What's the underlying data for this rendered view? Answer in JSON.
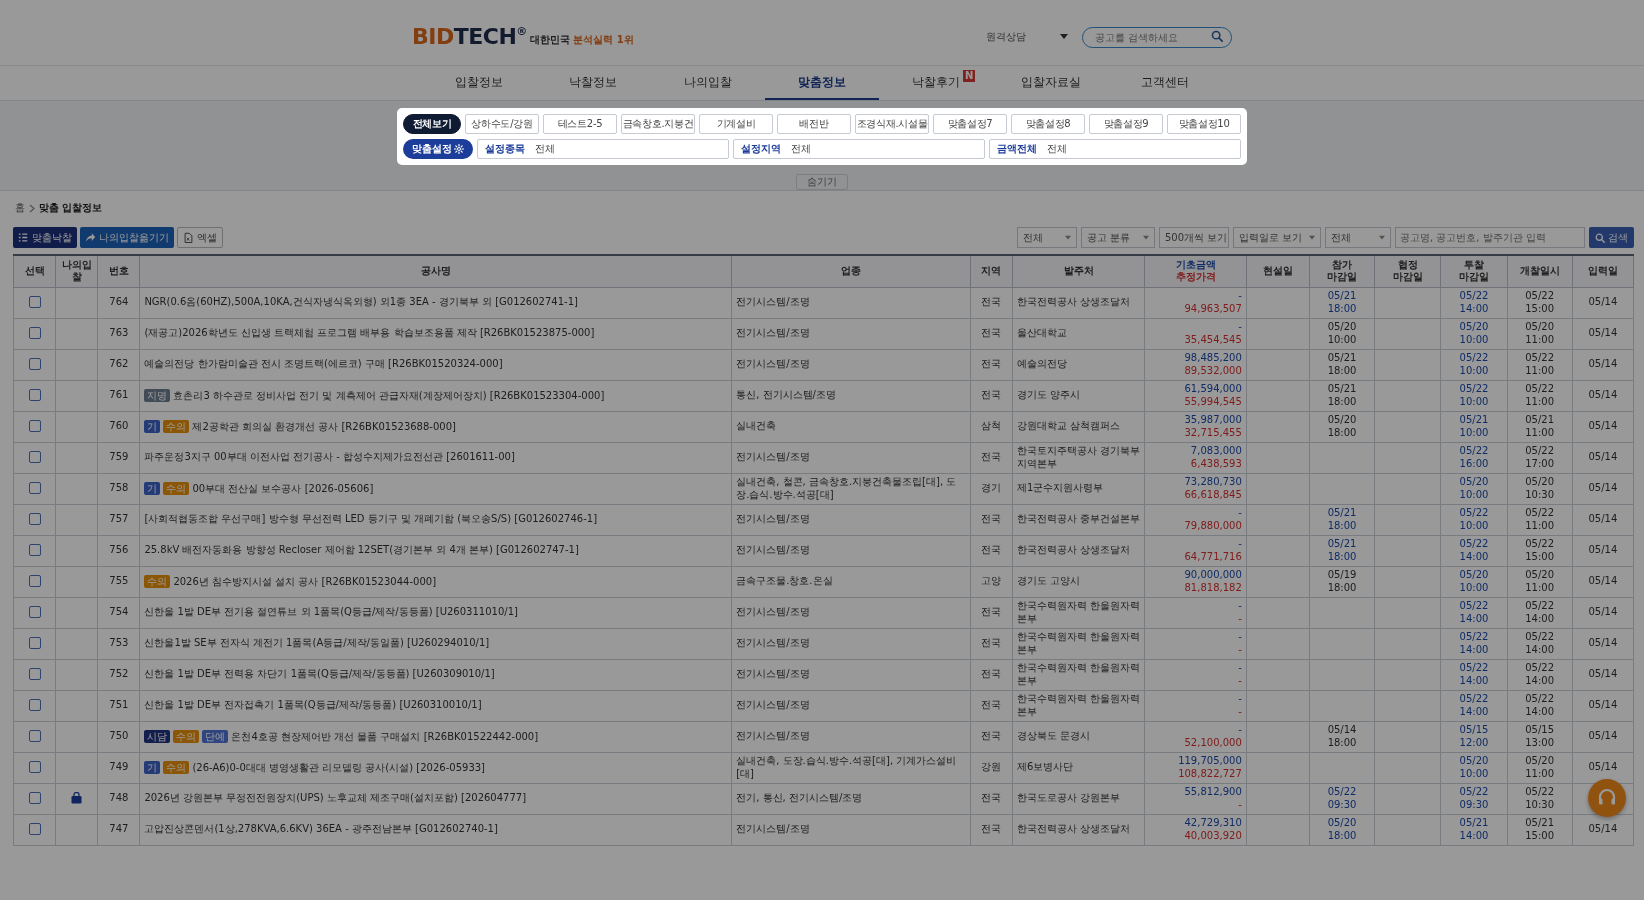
{
  "header": {
    "logo": {
      "part_1": "BID",
      "part_2": "TECH",
      "mark": "®"
    },
    "tagline": {
      "part_1": "대한민국",
      "part_2": "분석실력 1위"
    },
    "remote_support": "원격상담",
    "search": {
      "placeholder": "공고를 검색하세요"
    }
  },
  "nav": [
    {
      "label": "입찰정보",
      "selected": false
    },
    {
      "label": "낙찰정보",
      "selected": false
    },
    {
      "label": "나의입찰",
      "selected": false
    },
    {
      "label": "맞춤정보",
      "selected": true
    },
    {
      "label": "낙찰후기",
      "selected": false,
      "badge": "N"
    },
    {
      "label": "입찰자료실",
      "selected": false
    },
    {
      "label": "고객센터",
      "selected": false
    }
  ],
  "overlay": {
    "dimmed": true
  },
  "filter_panel": {
    "presets": [
      {
        "label": "전체보기",
        "selected": true
      },
      {
        "label": "상하수도/강원",
        "selected": false
      },
      {
        "label": "테스트2-5",
        "selected": false
      },
      {
        "label": "금속창호.지붕건",
        "selected": false
      },
      {
        "label": "기계설비",
        "selected": false
      },
      {
        "label": "배전반",
        "selected": false
      },
      {
        "label": "조경식재.시설물",
        "selected": false
      },
      {
        "label": "맞춤설정7",
        "selected": false
      },
      {
        "label": "맞춤설정8",
        "selected": false
      },
      {
        "label": "맞춤설정9",
        "selected": false
      },
      {
        "label": "맞춤설정10",
        "selected": false
      }
    ],
    "settings_button": "맞춤설정",
    "fields": [
      {
        "label": "설정종목",
        "value": "전체"
      },
      {
        "label": "설정지역",
        "value": "전체"
      },
      {
        "label": "금액전체",
        "value": "전체"
      }
    ]
  },
  "hide_button": "숨기기",
  "breadcrumb": [
    "홈",
    "맞춤 입찰정보"
  ],
  "toolbar": {
    "buttons": [
      {
        "label": "맞춤낙찰",
        "kind": "primary"
      },
      {
        "label": "나의입찰옮기기",
        "kind": "secondary"
      },
      {
        "label": "엑셀",
        "kind": "plain"
      }
    ],
    "selects": [
      "전체",
      "공고 분류",
      "500개씩 보기",
      "입력일로 보기",
      "전체"
    ],
    "search": {
      "placeholder": "공고명, 공고번호, 발주기관 입력"
    },
    "search_button": "검색"
  },
  "table": {
    "columns": [
      {
        "lines": [
          "선택"
        ],
        "kind": "plain"
      },
      {
        "lines": [
          "나의입찰"
        ],
        "kind": "plain"
      },
      {
        "lines": [
          "번호"
        ],
        "kind": "plain"
      },
      {
        "lines": [
          "공사명"
        ],
        "kind": "plain"
      },
      {
        "lines": [
          "업종"
        ],
        "kind": "plain"
      },
      {
        "lines": [
          "지역"
        ],
        "kind": "plain"
      },
      {
        "lines": [
          "발주처"
        ],
        "kind": "plain"
      },
      {
        "lines": [
          "기초금액",
          "추정가격"
        ],
        "kind": "price"
      },
      {
        "lines": [
          "현설일"
        ],
        "kind": "plain"
      },
      {
        "lines": [
          "참가",
          "마감일"
        ],
        "kind": "plain"
      },
      {
        "lines": [
          "협정",
          "마감일"
        ],
        "kind": "plain"
      },
      {
        "lines": [
          "투찰",
          "마감일"
        ],
        "kind": "plain"
      },
      {
        "lines": [
          "개찰일시"
        ],
        "kind": "plain"
      },
      {
        "lines": [
          "입력일"
        ],
        "kind": "plain"
      }
    ],
    "rows": [
      {
        "checked": false,
        "my_bid": false,
        "no": "764",
        "title": "NGR(0.6옴(60HZ),500A,10KA,건식자냉식옥외형) 외1종 3EA - 경기북부 외 [G012602741-1]",
        "industry": "전기시스템/조명",
        "region": "전국",
        "agency": "한국전력공사 상생조달처",
        "base_price": "-",
        "est_price": "94,963,507",
        "entry_deadline": {
          "date": "05/21",
          "time": "18:00",
          "emphasis": true
        },
        "bid_deadline": {
          "date": "05/22",
          "time": "14:00"
        },
        "opening": {
          "date": "05/22",
          "time": "15:00"
        },
        "input_date": "05/14"
      },
      {
        "checked": false,
        "my_bid": false,
        "no": "763",
        "title": "(재공고)2026학년도 신입생 트랙체험 프로그램 배부용 학습보조용품 제작 [R26BK01523875-000]",
        "industry": "전기시스템/조명",
        "region": "전국",
        "agency": "울산대학교",
        "base_price": "-",
        "est_price": "35,454,545",
        "entry_deadline": {
          "date": "05/20",
          "time": "10:00",
          "emphasis": false
        },
        "bid_deadline": {
          "date": "05/20",
          "time": "10:00"
        },
        "opening": {
          "date": "05/20",
          "time": "11:00"
        },
        "input_date": "05/14"
      },
      {
        "checked": false,
        "my_bid": false,
        "no": "762",
        "title": "예술의전당 한가람미술관 전시 조명트랙(에르코) 구매 [R26BK01520324-000]",
        "industry": "전기시스템/조명",
        "region": "전국",
        "agency": "예술의전당",
        "base_price": "98,485,200",
        "est_price": "89,532,000",
        "entry_deadline": {
          "date": "05/21",
          "time": "18:00",
          "emphasis": false
        },
        "bid_deadline": {
          "date": "05/22",
          "time": "10:00"
        },
        "opening": {
          "date": "05/22",
          "time": "11:00"
        },
        "input_date": "05/14"
      },
      {
        "checked": false,
        "my_bid": false,
        "no": "761",
        "tags": [
          {
            "label": "지명",
            "kind": "nominated"
          }
        ],
        "title": "효촌리3 하수관로 정비사업 전기 및 계측제어 관급자재(계장제어장치) [R26BK01523304-000]",
        "industry": "통신, 전기시스템/조명",
        "region": "전국",
        "agency": "경기도 양주시",
        "base_price": "61,594,000",
        "est_price": "55,994,545",
        "entry_deadline": {
          "date": "05/21",
          "time": "18:00",
          "emphasis": false
        },
        "bid_deadline": {
          "date": "05/22",
          "time": "10:00"
        },
        "opening": {
          "date": "05/22",
          "time": "11:00"
        },
        "input_date": "05/14"
      },
      {
        "checked": false,
        "my_bid": false,
        "no": "760",
        "tags": [
          {
            "label": "기",
            "kind": "gi"
          },
          {
            "label": "수의",
            "kind": "private"
          }
        ],
        "title": "제2공학관 회의실 환경개선 공사 [R26BK01523688-000]",
        "industry": "실내건축",
        "region": "삼척",
        "agency": "강원대학교 삼척캠퍼스",
        "base_price": "35,987,000",
        "est_price": "32,715,455",
        "entry_deadline": {
          "date": "05/20",
          "time": "18:00",
          "emphasis": false
        },
        "bid_deadline": {
          "date": "05/21",
          "time": "10:00"
        },
        "opening": {
          "date": "05/21",
          "time": "11:00"
        },
        "input_date": "05/14"
      },
      {
        "checked": false,
        "my_bid": false,
        "no": "759",
        "title": "파주운정3지구 00부대 이전사업 전기공사 - 합성수지제가요전선관 [2601611-00]",
        "industry": "전기시스템/조명",
        "region": "전국",
        "agency": "한국토지주택공사 경기북부지역본부",
        "base_price": "7,083,000",
        "est_price": "6,438,593",
        "bid_deadline": {
          "date": "05/22",
          "time": "16:00"
        },
        "opening": {
          "date": "05/22",
          "time": "17:00"
        },
        "input_date": "05/14"
      },
      {
        "checked": false,
        "my_bid": false,
        "no": "758",
        "tags": [
          {
            "label": "기",
            "kind": "gi"
          },
          {
            "label": "수의",
            "kind": "private"
          }
        ],
        "title": "00부대 전산실 보수공사 [2026-05606]",
        "industry": "실내건축, 철콘, 금속창호.지붕건축물조립[대], 도장.습식.방수.석공[대]",
        "region": "경기",
        "agency": "제1군수지원사령부",
        "base_price": "73,280,730",
        "est_price": "66,618,845",
        "bid_deadline": {
          "date": "05/20",
          "time": "10:00"
        },
        "opening": {
          "date": "05/20",
          "time": "10:30"
        },
        "input_date": "05/14"
      },
      {
        "checked": false,
        "my_bid": false,
        "no": "757",
        "title": "[사회적협동조합 우선구매] 방수형 무선전력 LED 등기구 및 개폐기함 (북오송S/S) [G012602746-1]",
        "industry": "전기시스템/조명",
        "region": "전국",
        "agency": "한국전력공사 중부건설본부",
        "base_price": "-",
        "est_price": "79,880,000",
        "entry_deadline": {
          "date": "05/21",
          "time": "18:00",
          "emphasis": true
        },
        "bid_deadline": {
          "date": "05/22",
          "time": "10:00"
        },
        "opening": {
          "date": "05/22",
          "time": "11:00"
        },
        "input_date": "05/14"
      },
      {
        "checked": false,
        "my_bid": false,
        "no": "756",
        "title": "25.8kV 배전자동화용 방향성 Recloser 제어함 12SET(경기본부 외 4개 본부) [G012602747-1]",
        "industry": "전기시스템/조명",
        "region": "전국",
        "agency": "한국전력공사 상생조달처",
        "base_price": "-",
        "est_price": "64,771,716",
        "entry_deadline": {
          "date": "05/21",
          "time": "18:00",
          "emphasis": true
        },
        "bid_deadline": {
          "date": "05/22",
          "time": "14:00"
        },
        "opening": {
          "date": "05/22",
          "time": "15:00"
        },
        "input_date": "05/14"
      },
      {
        "checked": false,
        "my_bid": false,
        "no": "755",
        "tags": [
          {
            "label": "수의",
            "kind": "private"
          }
        ],
        "title": "2026년 침수방지시설 설치 공사 [R26BK01523044-000]",
        "industry": "금속구조물.창호.온실",
        "region": "고양",
        "agency": "경기도 고양시",
        "base_price": "90,000,000",
        "est_price": "81,818,182",
        "entry_deadline": {
          "date": "05/19",
          "time": "18:00",
          "emphasis": false
        },
        "bid_deadline": {
          "date": "05/20",
          "time": "10:00"
        },
        "opening": {
          "date": "05/20",
          "time": "11:00"
        },
        "input_date": "05/14"
      },
      {
        "checked": false,
        "my_bid": false,
        "no": "754",
        "title": "신한울 1발 DE부 전기용 절연튜브 외 1품목(Q등급/제작/동등품) [U260311010/1]",
        "industry": "전기시스템/조명",
        "region": "전국",
        "agency": "한국수력원자력 한울원자력본부",
        "base_price": "-",
        "est_price": "-",
        "bid_deadline": {
          "date": "05/22",
          "time": "14:00"
        },
        "opening": {
          "date": "05/22",
          "time": "14:00"
        },
        "input_date": "05/14"
      },
      {
        "checked": false,
        "my_bid": false,
        "no": "753",
        "title": "신한울1발 SE부 전자식 계전기 1품목(A등급/제작/동일품) [U260294010/1]",
        "industry": "전기시스템/조명",
        "region": "전국",
        "agency": "한국수력원자력 한울원자력본부",
        "base_price": "-",
        "est_price": "-",
        "bid_deadline": {
          "date": "05/22",
          "time": "14:00"
        },
        "opening": {
          "date": "05/22",
          "time": "14:00"
        },
        "input_date": "05/14"
      },
      {
        "checked": false,
        "my_bid": false,
        "no": "752",
        "title": "신한울 1발 DE부 전력용 차단기 1품목(Q등급/제작/동등품) [U260309010/1]",
        "industry": "전기시스템/조명",
        "region": "전국",
        "agency": "한국수력원자력 한울원자력본부",
        "base_price": "-",
        "est_price": "-",
        "bid_deadline": {
          "date": "05/22",
          "time": "14:00"
        },
        "opening": {
          "date": "05/22",
          "time": "14:00"
        },
        "input_date": "05/14"
      },
      {
        "checked": false,
        "my_bid": false,
        "no": "751",
        "title": "신한울 1발 DE부 전자접촉기 1품목(Q등급/제작/동등품) [U260310010/1]",
        "industry": "전기시스템/조명",
        "region": "전국",
        "agency": "한국수력원자력 한울원자력본부",
        "base_price": "-",
        "est_price": "-",
        "bid_deadline": {
          "date": "05/22",
          "time": "14:00"
        },
        "opening": {
          "date": "05/22",
          "time": "14:00"
        },
        "input_date": "05/14"
      },
      {
        "checked": false,
        "my_bid": false,
        "no": "750",
        "tags": [
          {
            "label": "시담",
            "kind": "consult"
          },
          {
            "label": "수의",
            "kind": "private"
          },
          {
            "label": "단예",
            "kind": "unit"
          }
        ],
        "title": "온천4호공 현장제어반 개선 물품 구매설치 [R26BK01522442-000]",
        "industry": "전기시스템/조명",
        "region": "전국",
        "agency": "경상북도 문경시",
        "base_price": "-",
        "est_price": "52,100,000",
        "entry_deadline": {
          "date": "05/14",
          "time": "18:00",
          "emphasis": false
        },
        "bid_deadline": {
          "date": "05/15",
          "time": "12:00"
        },
        "opening": {
          "date": "05/15",
          "time": "13:00"
        },
        "input_date": "05/14"
      },
      {
        "checked": false,
        "my_bid": false,
        "no": "749",
        "tags": [
          {
            "label": "기",
            "kind": "gi"
          },
          {
            "label": "수의",
            "kind": "private"
          }
        ],
        "title": "(26-A6)0-0대대 병영생활관 리모델링 공사(시설) [2026-05933]",
        "industry": "실내건축, 도장.습식.방수.석공[대], 기계가스설비[대]",
        "region": "강원",
        "agency": "제6보병사단",
        "base_price": "119,705,000",
        "est_price": "108,822,727",
        "bid_deadline": {
          "date": "05/20",
          "time": "10:00"
        },
        "opening": {
          "date": "05/20",
          "time": "11:00"
        },
        "input_date": "05/14"
      },
      {
        "checked": false,
        "my_bid": true,
        "no": "748",
        "title": "2026년 강원본부 무정전전원장치(UPS) 노후교체 제조구매(설치포함) [202604777]",
        "industry": "전기, 통신, 전기시스템/조명",
        "region": "전국",
        "agency": "한국도로공사 강원본부",
        "base_price": "55,812,900",
        "est_price": "-",
        "entry_deadline": {
          "date": "05/22",
          "time": "09:30",
          "emphasis": true
        },
        "bid_deadline": {
          "date": "05/22",
          "time": "09:30"
        },
        "opening": {
          "date": "05/22",
          "time": "10:30"
        }
      },
      {
        "checked": false,
        "my_bid": false,
        "no": "747",
        "title": "고압진상콘덴서(1상,278KVA,6.6KV) 36EA - 광주전남본부 [G012602740-1]",
        "industry": "전기시스템/조명",
        "region": "전국",
        "agency": "한국전력공사 상생조달처",
        "base_price": "42,729,310",
        "est_price": "40,003,920",
        "entry_deadline": {
          "date": "05/20",
          "time": "18:00",
          "emphasis": true
        },
        "bid_deadline": {
          "date": "05/21",
          "time": "14:00"
        },
        "opening": {
          "date": "05/21",
          "time": "15:00"
        },
        "input_date": "05/14"
      }
    ]
  }
}
